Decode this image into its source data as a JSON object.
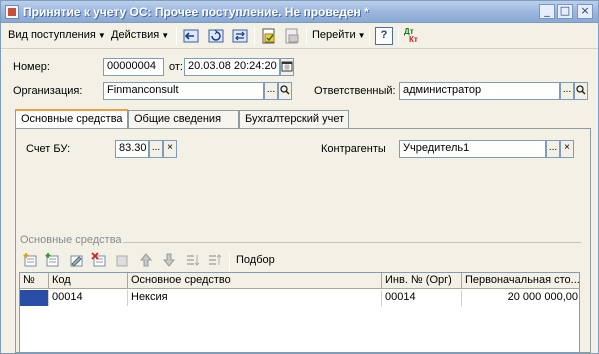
{
  "window": {
    "title": "Принятие к учету ОС: Прочее поступление. Не проведен *",
    "btn_min": "_",
    "btn_max": "□",
    "btn_close": "×"
  },
  "toolbar": {
    "menu_receipt_type": "Вид поступления",
    "menu_actions": "Действия",
    "menu_goto": "Перейти",
    "help_label": "?",
    "dt_kt_top": "Дт",
    "dt_kt_bottom": "Кт"
  },
  "header": {
    "number_label": "Номер:",
    "number_value": "00000004",
    "date_label": "от:",
    "date_value": "20.03.08 20:24:20",
    "org_label": "Организация:",
    "org_value": "Finmanconsult",
    "responsible_label": "Ответственный:",
    "responsible_value": "администратор"
  },
  "tabs": [
    "Основные средства",
    "Общие сведения",
    "Бухгалтерский учет"
  ],
  "panel": {
    "account_label": "Счет БУ:",
    "account_value": "83.30",
    "contractors_label": "Контрагенты",
    "contractors_value": "Учредитель1",
    "section_title": "Основные средства",
    "pick_label": "Подбор"
  },
  "grid": {
    "columns": [
      "№",
      "Код",
      "Основное средство",
      "Инв. № (Орг)",
      "Первоначальная сто..."
    ],
    "rows": [
      {
        "num": "",
        "code": "00014",
        "asset": "Нексия",
        "inv": "00014",
        "cost": "20 000 000,00"
      }
    ]
  },
  "icons": {
    "ellipsis": "...",
    "search": "search-icon",
    "clear": "×",
    "calendar": "calendar-icon"
  }
}
